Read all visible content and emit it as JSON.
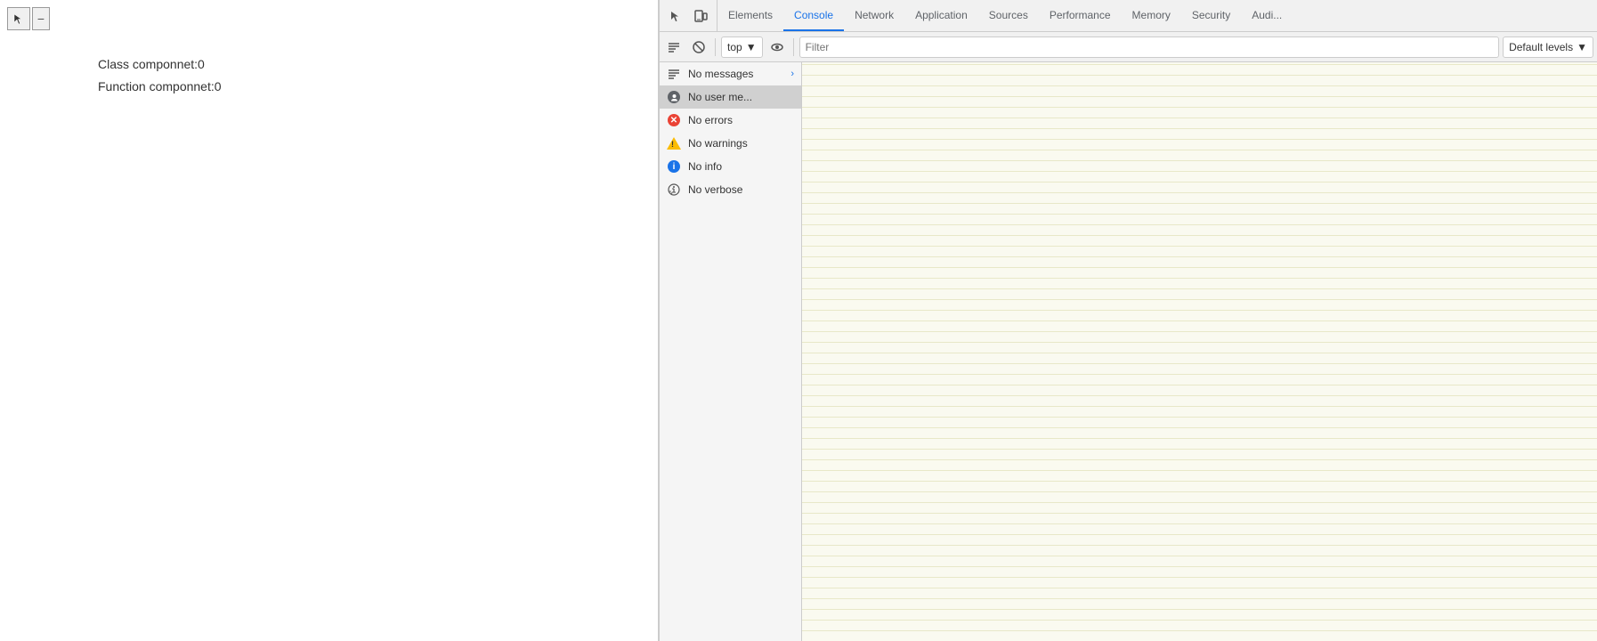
{
  "page": {
    "class_component": "Class componnet:0",
    "function_component": "Function componnet:0"
  },
  "devtools": {
    "tabs": [
      {
        "id": "elements",
        "label": "Elements",
        "active": false
      },
      {
        "id": "console",
        "label": "Console",
        "active": true
      },
      {
        "id": "network",
        "label": "Network",
        "active": false
      },
      {
        "id": "application",
        "label": "Application",
        "active": false
      },
      {
        "id": "sources",
        "label": "Sources",
        "active": false
      },
      {
        "id": "performance",
        "label": "Performance",
        "active": false
      },
      {
        "id": "memory",
        "label": "Memory",
        "active": false
      },
      {
        "id": "security",
        "label": "Security",
        "active": false
      },
      {
        "id": "audits",
        "label": "Audi...",
        "active": false
      }
    ],
    "toolbar": {
      "context_value": "top",
      "filter_placeholder": "Filter",
      "levels_value": "Default levels"
    },
    "sidebar": {
      "items": [
        {
          "id": "messages",
          "icon": "list-icon",
          "label": "No messages",
          "selected": false,
          "has_chevron": true
        },
        {
          "id": "user-messages",
          "icon": "user-icon",
          "label": "No user me...",
          "selected": true
        },
        {
          "id": "errors",
          "icon": "error-icon",
          "label": "No errors",
          "selected": false
        },
        {
          "id": "warnings",
          "icon": "warning-icon",
          "label": "No warnings",
          "selected": false
        },
        {
          "id": "info",
          "icon": "info-icon",
          "label": "No info",
          "selected": false
        },
        {
          "id": "verbose",
          "icon": "verbose-icon",
          "label": "No verbose",
          "selected": false
        }
      ]
    }
  }
}
